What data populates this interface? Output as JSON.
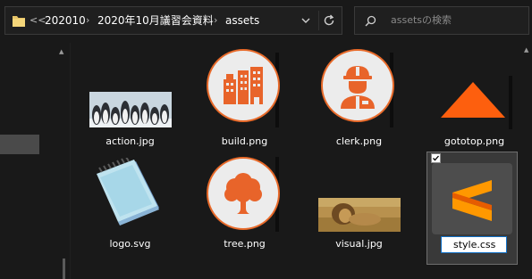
{
  "address_bar": {
    "overflow_label": "<<",
    "breadcrumbs": [
      "202010",
      "2020年10月議習会資料",
      "assets"
    ]
  },
  "search": {
    "placeholder": "assetsの検索"
  },
  "files": [
    {
      "name": "action.jpg",
      "icon": "penguins-thumbnail"
    },
    {
      "name": "build.png",
      "icon": "buildings-icon"
    },
    {
      "name": "clerk.png",
      "icon": "worker-icon"
    },
    {
      "name": "gototop.png",
      "icon": "triangle-icon"
    },
    {
      "name": "logo.svg",
      "icon": "notepad-icon"
    },
    {
      "name": "tree.png",
      "icon": "tree-icon"
    },
    {
      "name": "visual.jpg",
      "icon": "lion-thumbnail"
    },
    {
      "name": "style.css",
      "icon": "sublime-text-icon",
      "selected": true,
      "renaming": true
    }
  ],
  "colors": {
    "accent_orange": "#e8642a",
    "background": "#191919",
    "selection": "#393939"
  }
}
